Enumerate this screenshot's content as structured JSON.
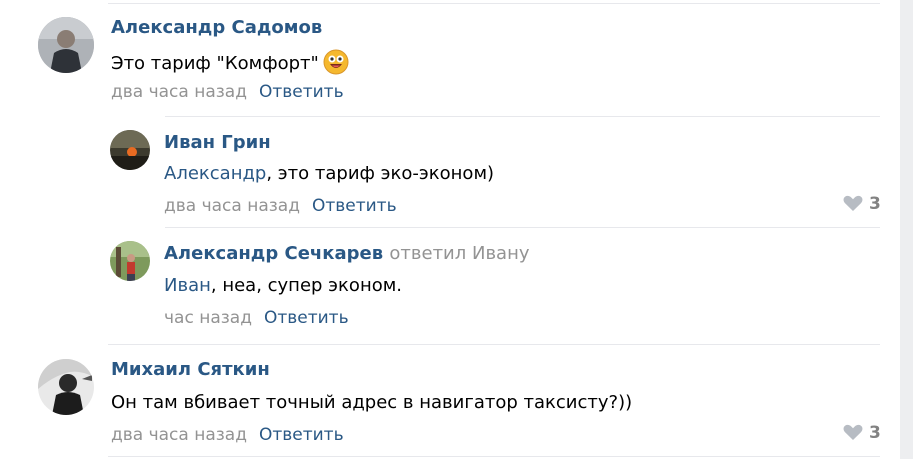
{
  "comments": [
    {
      "author": "Александр Садомов",
      "text": "Это тариф \"Комфорт\"",
      "emoji": "grinning-face-emoji",
      "time": "два часа назад",
      "reply_label": "Ответить"
    },
    {
      "author": "Иван Грин",
      "mention": "Александр",
      "text": ", это тариф эко-эконом)",
      "time": "два часа назад",
      "reply_label": "Ответить",
      "likes": "3"
    },
    {
      "author": "Александр Сечкарев",
      "replied_to": "ответил Ивану",
      "mention": "Иван",
      "text": ", неа, супер эконом.",
      "time": "час назад",
      "reply_label": "Ответить"
    },
    {
      "author": "Михаил Сяткин",
      "text": "Он там вбивает точный адрес в навигатор таксисту?))",
      "time": "два часа назад",
      "reply_label": "Ответить",
      "likes": "3"
    }
  ],
  "icons": {
    "like": "heart-icon"
  },
  "colors": {
    "link": "#2a5885",
    "muted": "#939393",
    "separator": "#e7e8ec",
    "background": "#edeef0"
  }
}
